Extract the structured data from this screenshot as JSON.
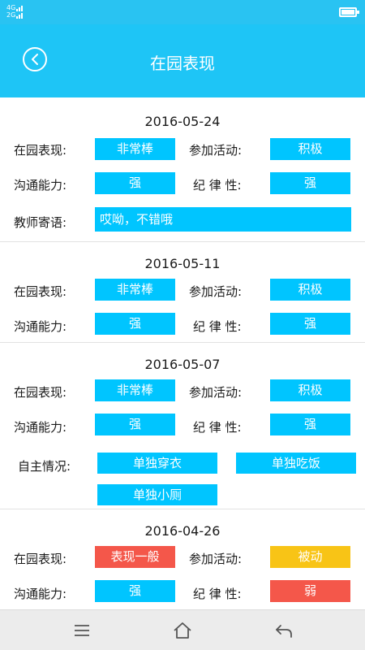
{
  "status_bar": {
    "network_top": "4G",
    "network_bottom": "2G",
    "signal_icon": "signal-icon",
    "battery_icon": "battery-icon"
  },
  "header": {
    "title": "在园表现",
    "back_icon": "chevron-left-icon"
  },
  "labels": {
    "performance": "在园表现:",
    "activity": "参加活动:",
    "communication": "沟通能力:",
    "discipline": "纪 律 性:",
    "teacher_message": "教师寄语:",
    "independence": "自主情况:"
  },
  "records": [
    {
      "date": "2016-05-24",
      "performance": "非常棒",
      "activity": "积极",
      "communication": "强",
      "discipline": "强",
      "teacher_message": "哎呦，不错哦"
    },
    {
      "date": "2016-05-11",
      "performance": "非常棒",
      "activity": "积极",
      "communication": "强",
      "discipline": "强"
    },
    {
      "date": "2016-05-07",
      "performance": "非常棒",
      "activity": "积极",
      "communication": "强",
      "discipline": "强",
      "independence": [
        "单独穿衣",
        "单独吃饭",
        "单独小厕"
      ]
    },
    {
      "date": "2016-04-26",
      "performance": "表现一般",
      "activity": "被动",
      "communication": "强",
      "discipline": "弱"
    }
  ],
  "colors": {
    "header": "#1ec5f6",
    "tag": "#00c5ff",
    "tag_warning": "#f4574a",
    "tag_caution": "#f8c416",
    "navbar": "#ececec"
  },
  "nav": {
    "menu_icon": "menu-icon",
    "home_icon": "home-icon",
    "back_icon": "back-arrow-icon"
  }
}
